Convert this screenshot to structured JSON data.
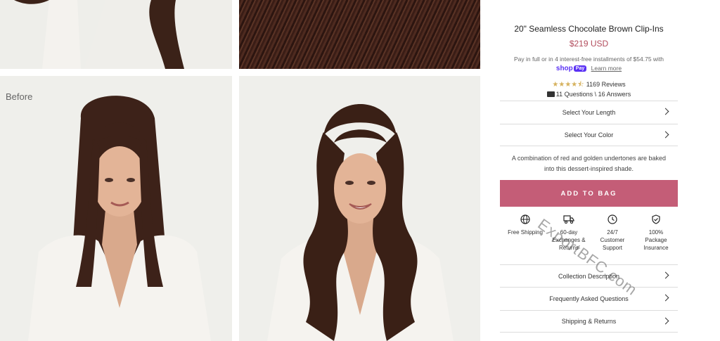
{
  "gallery": {
    "before_label": "Before"
  },
  "product": {
    "title": "20\" Seamless Chocolate Brown Clip-Ins",
    "price": "$219 USD",
    "installment_text": "Pay in full or in 4 interest-free installments of $54.75 with",
    "shoppay_shop": "shop",
    "shoppay_pay": "Pay",
    "learn_more": "Learn more",
    "rating": 4.5,
    "reviews_label": "1169 Reviews",
    "qa_label": "11 Questions \\ 16 Answers",
    "select_length": "Select Your Length",
    "select_color": "Select Your Color",
    "description": "A combination of red and golden undertones are baked into this dessert-inspired shade.",
    "add_to_bag": "ADD TO BAG"
  },
  "features": [
    {
      "icon": "globe-icon",
      "label": "Free Shipping"
    },
    {
      "icon": "truck-icon",
      "label": "60-day Exchanges & Returns"
    },
    {
      "icon": "clock-icon",
      "label": "24/7 Customer Support"
    },
    {
      "icon": "shield-check-icon",
      "label": "100% Package Insurance"
    }
  ],
  "accordions": {
    "collection": "Collection Description",
    "faq": "Frequently Asked Questions",
    "shipping": "Shipping & Returns"
  },
  "watermark": "ExportBFC.com",
  "colors": {
    "accent": "#c45d77",
    "price": "#b24c5c",
    "shoppay": "#5a31f4",
    "star": "#d6b25e"
  }
}
